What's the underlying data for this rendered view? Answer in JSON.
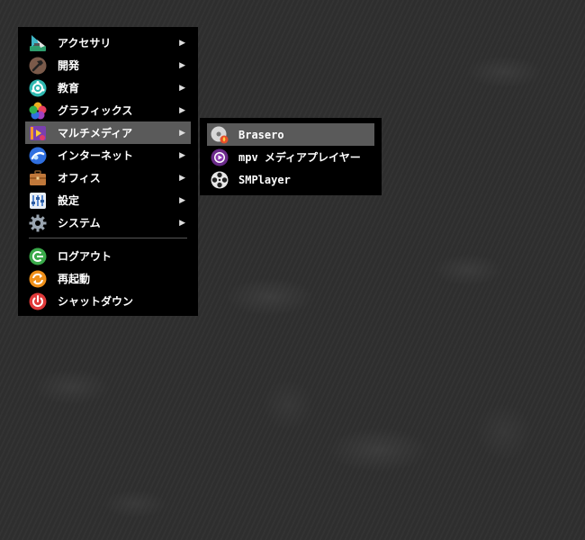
{
  "main_menu": {
    "items": [
      {
        "label": "アクセサリ",
        "icon": "accessories-icon",
        "submenu": true
      },
      {
        "label": "開発",
        "icon": "hammer-icon",
        "submenu": true
      },
      {
        "label": "教育",
        "icon": "education-icon",
        "submenu": true
      },
      {
        "label": "グラフィックス",
        "icon": "graphics-icon",
        "submenu": true
      },
      {
        "label": "マルチメディア",
        "icon": "multimedia-icon",
        "submenu": true,
        "selected": true
      },
      {
        "label": "インターネット",
        "icon": "globe-icon",
        "submenu": true
      },
      {
        "label": "オフィス",
        "icon": "briefcase-icon",
        "submenu": true
      },
      {
        "label": "設定",
        "icon": "settings-icon",
        "submenu": true
      },
      {
        "label": "システム",
        "icon": "gear-icon",
        "submenu": true
      }
    ],
    "session": [
      {
        "label": "ログアウト",
        "icon": "logout-icon"
      },
      {
        "label": "再起動",
        "icon": "restart-icon"
      },
      {
        "label": "シャットダウン",
        "icon": "power-icon"
      }
    ],
    "arrow": "▶"
  },
  "sub_menu": {
    "items": [
      {
        "label": "Brasero",
        "icon": "disc-burner-icon",
        "selected": true
      },
      {
        "label": "mpv メディアプレイヤー",
        "icon": "mpv-icon"
      },
      {
        "label": "SMPlayer",
        "icon": "film-reel-icon"
      }
    ]
  },
  "colors": {
    "menu_bg": "#000000",
    "highlight": "#5a5a5a",
    "text": "#ffffff"
  }
}
